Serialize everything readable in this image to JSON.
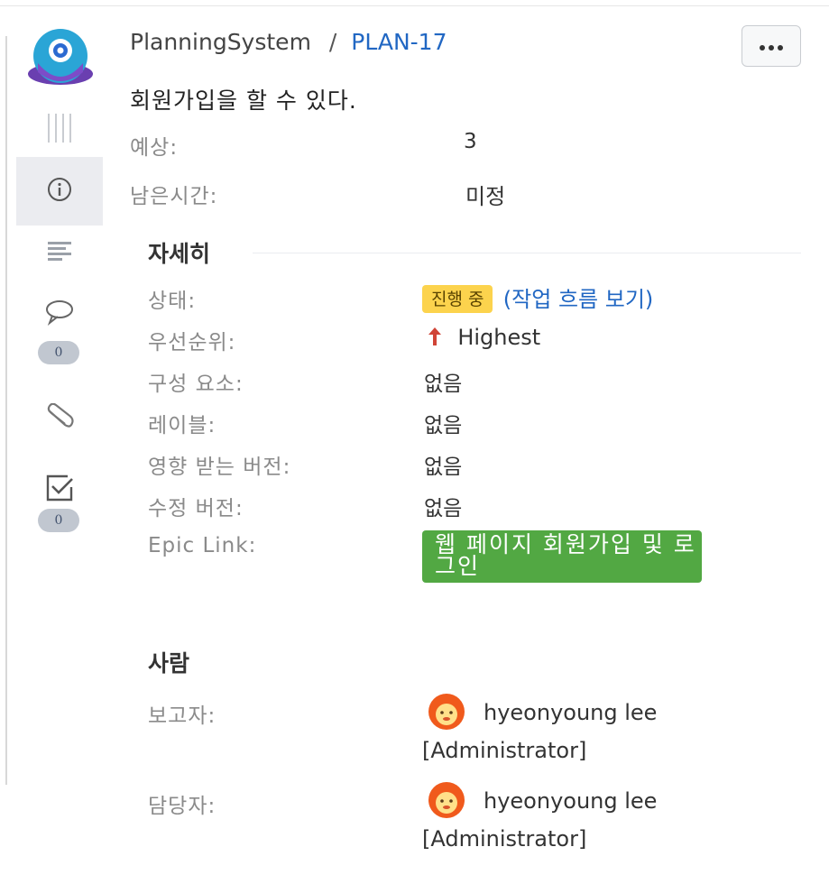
{
  "header": {
    "project": "PlanningSystem",
    "separator": "/",
    "issue_key": "PLAN-17",
    "more_label": "•••"
  },
  "summary": "회원가입을 할 수 있다.",
  "top_fields": [
    {
      "label": "예상:",
      "value": "3"
    },
    {
      "label": "남은시간:",
      "value": "미정"
    }
  ],
  "sidebar": {
    "comment_count": "0",
    "checklist_count": "0"
  },
  "details": {
    "title": "자세히",
    "status_label": "상태:",
    "status_value": "진행 중",
    "workflow_open": "(",
    "workflow_link": "작업 흐름 보기",
    "workflow_close": ")",
    "priority_label": "우선순위:",
    "priority_value": "Highest",
    "priority_color": "#d04437",
    "components_label": "구성 요소:",
    "components_value": "없음",
    "labels_label": "레이블:",
    "labels_value": "없음",
    "affects_label": "영향 받는 버전:",
    "affects_value": "없음",
    "fix_label": "수정 버전:",
    "fix_value": "없음",
    "epic_label": "Epic Link:",
    "epic_value": "웹 페이지 회원가입 및 로그인",
    "epic_color": "#52a843",
    "status_color": "#fcd34d"
  },
  "people": {
    "title": "사람",
    "reporter_label": "보고자:",
    "reporter_name": "hyeonyoung lee",
    "reporter_role": "[Administrator]",
    "assignee_label": "담당자:",
    "assignee_name": "hyeonyoung lee",
    "assignee_role": "[Administrator]"
  },
  "icons": {
    "logo": "project-robot-icon",
    "drag": "drag-handle-icon",
    "info": "info-icon",
    "description": "description-icon",
    "comment": "comment-icon",
    "attachment": "paperclip-icon",
    "checklist": "checklist-icon",
    "priority": "arrow-up-icon",
    "avatar": "user-avatar-icon"
  }
}
